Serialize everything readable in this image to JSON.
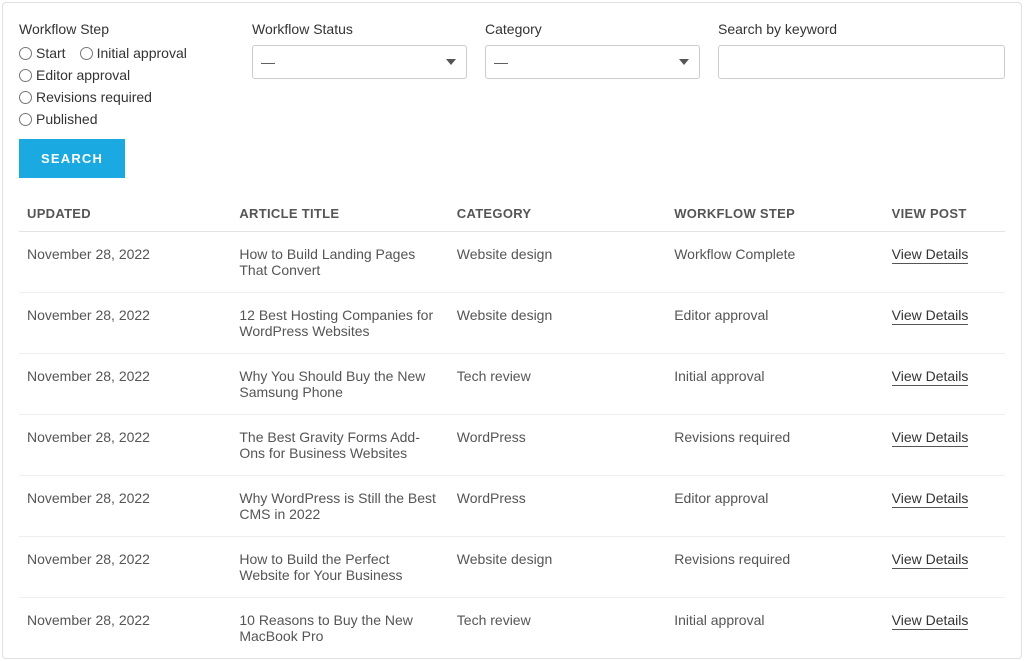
{
  "filters": {
    "workflow_step": {
      "label": "Workflow Step",
      "options": [
        "Start",
        "Initial approval",
        "Editor approval",
        "Revisions required",
        "Published"
      ]
    },
    "workflow_status": {
      "label": "Workflow Status",
      "selected": "—"
    },
    "category": {
      "label": "Category",
      "selected": "—"
    },
    "keyword": {
      "label": "Search by keyword",
      "value": ""
    },
    "search_button": "SEARCH"
  },
  "table": {
    "headers": {
      "updated": "UPDATED",
      "title": "ARTICLE TITLE",
      "category": "CATEGORY",
      "step": "WORKFLOW STEP",
      "view": "VIEW POST"
    },
    "view_details_label": "View Details",
    "rows": [
      {
        "updated": "November 28, 2022",
        "title": "How to Build Landing Pages That Convert",
        "category": "Website design",
        "step": "Workflow Complete"
      },
      {
        "updated": "November 28, 2022",
        "title": "12 Best Hosting Companies for WordPress Websites",
        "category": "Website design",
        "step": "Editor approval"
      },
      {
        "updated": "November 28, 2022",
        "title": "Why You Should Buy the New Samsung Phone",
        "category": "Tech review",
        "step": "Initial approval"
      },
      {
        "updated": "November 28, 2022",
        "title": "The Best Gravity Forms Add-Ons for Business Websites",
        "category": "WordPress",
        "step": "Revisions required"
      },
      {
        "updated": "November 28, 2022",
        "title": "Why WordPress is Still the Best CMS in 2022",
        "category": "WordPress",
        "step": "Editor approval"
      },
      {
        "updated": "November 28, 2022",
        "title": "How to Build the Perfect Website for Your Business",
        "category": "Website design",
        "step": "Revisions required"
      },
      {
        "updated": "November 28, 2022",
        "title": "10 Reasons to Buy the New MacBook Pro",
        "category": "Tech review",
        "step": "Initial approval"
      }
    ]
  }
}
